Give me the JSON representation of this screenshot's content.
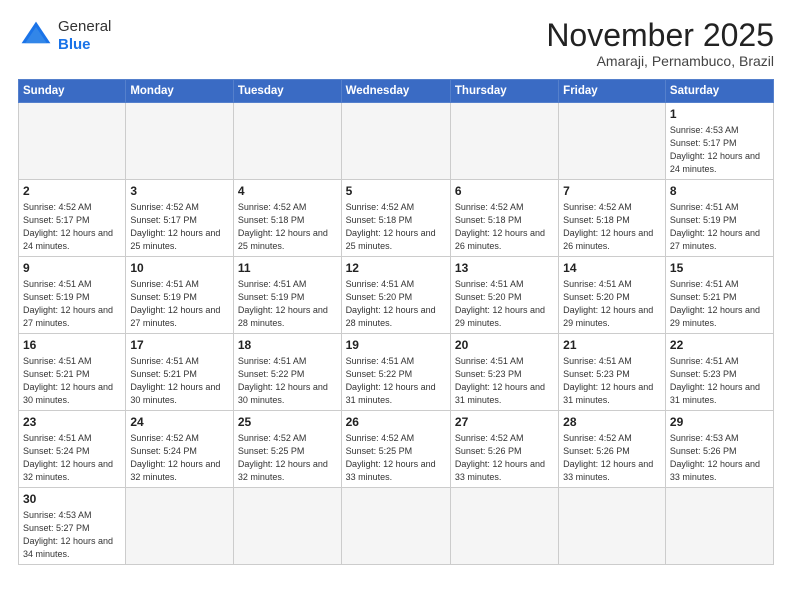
{
  "header": {
    "logo_general": "General",
    "logo_blue": "Blue",
    "month_title": "November 2025",
    "location": "Amaraji, Pernambuco, Brazil"
  },
  "days_of_week": [
    "Sunday",
    "Monday",
    "Tuesday",
    "Wednesday",
    "Thursday",
    "Friday",
    "Saturday"
  ],
  "weeks": [
    [
      {
        "day": "",
        "info": ""
      },
      {
        "day": "",
        "info": ""
      },
      {
        "day": "",
        "info": ""
      },
      {
        "day": "",
        "info": ""
      },
      {
        "day": "",
        "info": ""
      },
      {
        "day": "",
        "info": ""
      },
      {
        "day": "1",
        "info": "Sunrise: 4:53 AM\nSunset: 5:17 PM\nDaylight: 12 hours and 24 minutes."
      }
    ],
    [
      {
        "day": "2",
        "info": "Sunrise: 4:52 AM\nSunset: 5:17 PM\nDaylight: 12 hours and 24 minutes."
      },
      {
        "day": "3",
        "info": "Sunrise: 4:52 AM\nSunset: 5:17 PM\nDaylight: 12 hours and 25 minutes."
      },
      {
        "day": "4",
        "info": "Sunrise: 4:52 AM\nSunset: 5:18 PM\nDaylight: 12 hours and 25 minutes."
      },
      {
        "day": "5",
        "info": "Sunrise: 4:52 AM\nSunset: 5:18 PM\nDaylight: 12 hours and 25 minutes."
      },
      {
        "day": "6",
        "info": "Sunrise: 4:52 AM\nSunset: 5:18 PM\nDaylight: 12 hours and 26 minutes."
      },
      {
        "day": "7",
        "info": "Sunrise: 4:52 AM\nSunset: 5:18 PM\nDaylight: 12 hours and 26 minutes."
      },
      {
        "day": "8",
        "info": "Sunrise: 4:51 AM\nSunset: 5:19 PM\nDaylight: 12 hours and 27 minutes."
      }
    ],
    [
      {
        "day": "9",
        "info": "Sunrise: 4:51 AM\nSunset: 5:19 PM\nDaylight: 12 hours and 27 minutes."
      },
      {
        "day": "10",
        "info": "Sunrise: 4:51 AM\nSunset: 5:19 PM\nDaylight: 12 hours and 27 minutes."
      },
      {
        "day": "11",
        "info": "Sunrise: 4:51 AM\nSunset: 5:19 PM\nDaylight: 12 hours and 28 minutes."
      },
      {
        "day": "12",
        "info": "Sunrise: 4:51 AM\nSunset: 5:20 PM\nDaylight: 12 hours and 28 minutes."
      },
      {
        "day": "13",
        "info": "Sunrise: 4:51 AM\nSunset: 5:20 PM\nDaylight: 12 hours and 29 minutes."
      },
      {
        "day": "14",
        "info": "Sunrise: 4:51 AM\nSunset: 5:20 PM\nDaylight: 12 hours and 29 minutes."
      },
      {
        "day": "15",
        "info": "Sunrise: 4:51 AM\nSunset: 5:21 PM\nDaylight: 12 hours and 29 minutes."
      }
    ],
    [
      {
        "day": "16",
        "info": "Sunrise: 4:51 AM\nSunset: 5:21 PM\nDaylight: 12 hours and 30 minutes."
      },
      {
        "day": "17",
        "info": "Sunrise: 4:51 AM\nSunset: 5:21 PM\nDaylight: 12 hours and 30 minutes."
      },
      {
        "day": "18",
        "info": "Sunrise: 4:51 AM\nSunset: 5:22 PM\nDaylight: 12 hours and 30 minutes."
      },
      {
        "day": "19",
        "info": "Sunrise: 4:51 AM\nSunset: 5:22 PM\nDaylight: 12 hours and 31 minutes."
      },
      {
        "day": "20",
        "info": "Sunrise: 4:51 AM\nSunset: 5:23 PM\nDaylight: 12 hours and 31 minutes."
      },
      {
        "day": "21",
        "info": "Sunrise: 4:51 AM\nSunset: 5:23 PM\nDaylight: 12 hours and 31 minutes."
      },
      {
        "day": "22",
        "info": "Sunrise: 4:51 AM\nSunset: 5:23 PM\nDaylight: 12 hours and 31 minutes."
      }
    ],
    [
      {
        "day": "23",
        "info": "Sunrise: 4:51 AM\nSunset: 5:24 PM\nDaylight: 12 hours and 32 minutes."
      },
      {
        "day": "24",
        "info": "Sunrise: 4:52 AM\nSunset: 5:24 PM\nDaylight: 12 hours and 32 minutes."
      },
      {
        "day": "25",
        "info": "Sunrise: 4:52 AM\nSunset: 5:25 PM\nDaylight: 12 hours and 32 minutes."
      },
      {
        "day": "26",
        "info": "Sunrise: 4:52 AM\nSunset: 5:25 PM\nDaylight: 12 hours and 33 minutes."
      },
      {
        "day": "27",
        "info": "Sunrise: 4:52 AM\nSunset: 5:26 PM\nDaylight: 12 hours and 33 minutes."
      },
      {
        "day": "28",
        "info": "Sunrise: 4:52 AM\nSunset: 5:26 PM\nDaylight: 12 hours and 33 minutes."
      },
      {
        "day": "29",
        "info": "Sunrise: 4:53 AM\nSunset: 5:26 PM\nDaylight: 12 hours and 33 minutes."
      }
    ],
    [
      {
        "day": "30",
        "info": "Sunrise: 4:53 AM\nSunset: 5:27 PM\nDaylight: 12 hours and 34 minutes."
      },
      {
        "day": "",
        "info": ""
      },
      {
        "day": "",
        "info": ""
      },
      {
        "day": "",
        "info": ""
      },
      {
        "day": "",
        "info": ""
      },
      {
        "day": "",
        "info": ""
      },
      {
        "day": "",
        "info": ""
      }
    ]
  ]
}
